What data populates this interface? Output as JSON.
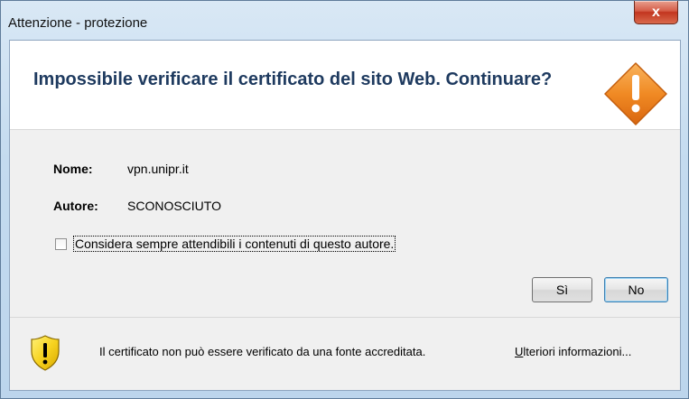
{
  "window": {
    "title": "Attenzione - protezione",
    "close_label": "x"
  },
  "header": {
    "heading": "Impossibile verificare il certificato del sito Web. Continuare?",
    "icon": "warning-diamond-icon"
  },
  "details": {
    "name_label": "Nome:",
    "name_value": "vpn.unipr.it",
    "author_label": "Autore:",
    "author_value": "SCONOSCIUTO"
  },
  "checkbox": {
    "label": "Considera sempre attendibili i contenuti di questo autore.",
    "checked": false
  },
  "buttons": {
    "yes": "Sì",
    "no": "No"
  },
  "footer": {
    "icon": "warning-shield-icon",
    "message": "Il certificato non può essere verificato da una fonte accreditata.",
    "more_info_first": "U",
    "more_info_rest": "lteriori informazioni..."
  },
  "colors": {
    "heading": "#1e3a5f",
    "warning_orange": "#f08a24",
    "shield_yellow": "#f7d320",
    "close_red": "#c7432d"
  }
}
